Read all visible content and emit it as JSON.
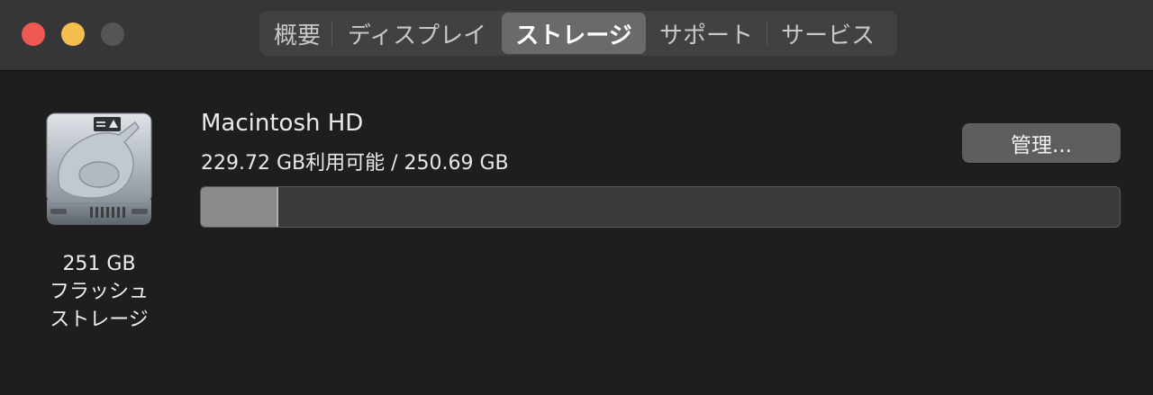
{
  "window": {
    "traffic_lights": [
      "close",
      "minimize",
      "zoom"
    ],
    "colors": {
      "close": "#ee5a52",
      "minimize": "#f5bf4f",
      "zoom_disabled": "#555457"
    }
  },
  "tabs": [
    {
      "label": "概要",
      "active": false
    },
    {
      "label": "ディスプレイ",
      "active": false
    },
    {
      "label": "ストレージ",
      "active": true
    },
    {
      "label": "サポート",
      "active": false
    },
    {
      "label": "サービス",
      "active": false
    }
  ],
  "drive": {
    "icon": "hard-drive-icon",
    "size_label": "251 GB",
    "type_line1": "フラッシュ",
    "type_line2": "ストレージ"
  },
  "disk": {
    "name": "Macintosh HD",
    "capacity": "229.72 GB利用可能 / 250.69 GB",
    "used_fraction": 0.084
  },
  "manage_button": {
    "label": "管理..."
  }
}
